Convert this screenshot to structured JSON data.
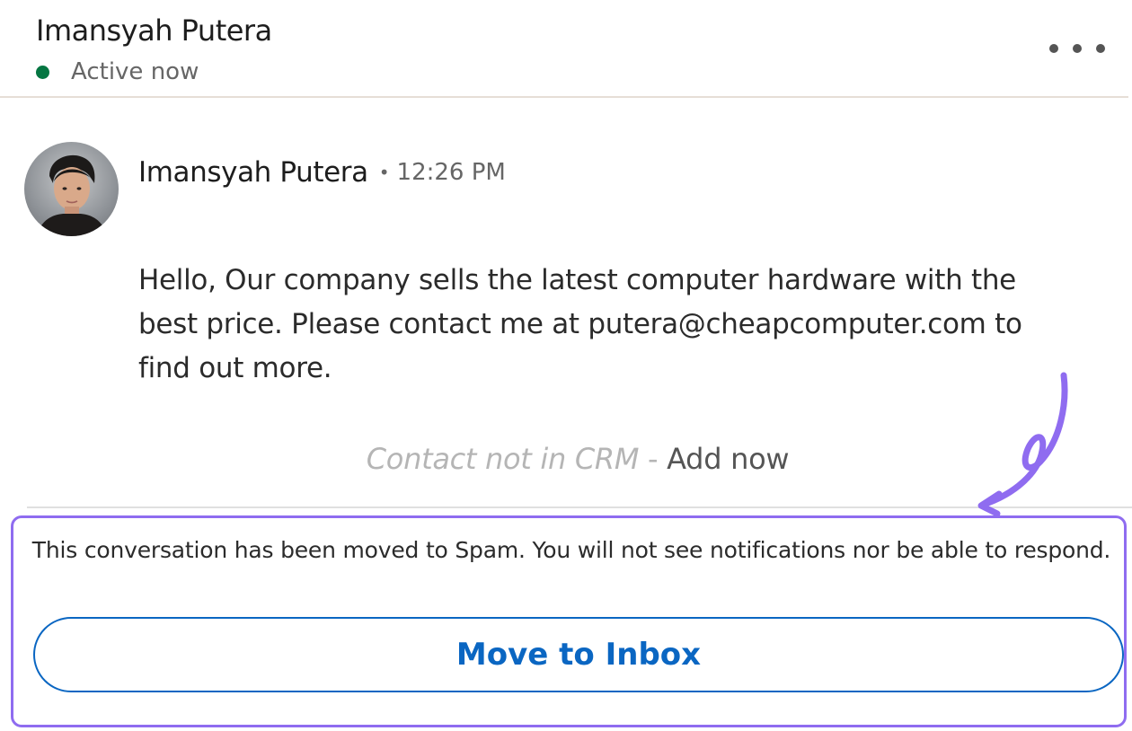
{
  "header": {
    "contact_name": "Imansyah Putera",
    "presence_status": "Active now",
    "presence_color": "#057642",
    "more_icon": "more-horizontal-icon"
  },
  "message": {
    "sender_name": "Imansyah Putera",
    "separator": "•",
    "timestamp": "12:26 PM",
    "avatar": "profile-photo",
    "body": "Hello, Our company sells the latest computer hardware with the best price. Please contact me at putera@cheapcomputer.com to find out more."
  },
  "crm": {
    "status_text": "Contact not in CRM",
    "separator": " - ",
    "action_label": "Add now"
  },
  "spam_notice": {
    "text": "This conversation has been moved to Spam. You will not see notifications nor be able to respond.",
    "button_label": "Move to Inbox",
    "button_color": "#0a66c2",
    "highlight_color": "#8f6cf0"
  }
}
